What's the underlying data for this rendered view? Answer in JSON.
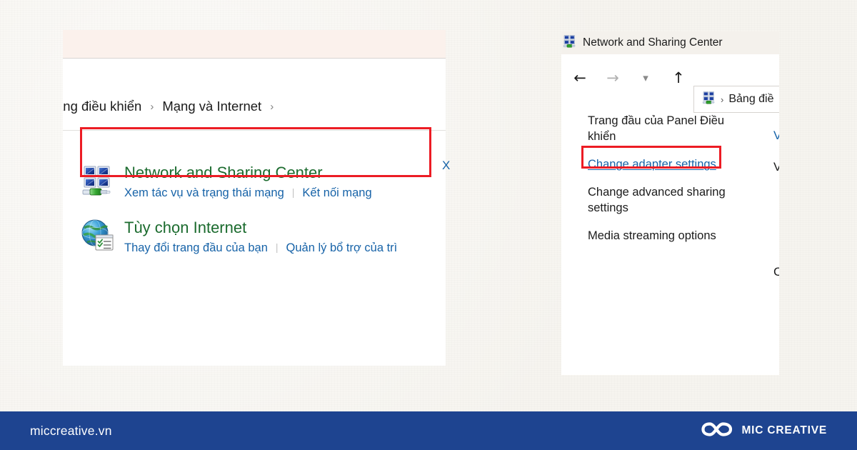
{
  "footer": {
    "url": "miccreative.vn",
    "brand_name": "MIC CREATIVE",
    "logo_icon": "infinity-loop-icon",
    "background_color": "#1e4490",
    "text_color": "#ffffff"
  },
  "left_window": {
    "breadcrumb": {
      "items": [
        "ảng điều khiển",
        "Mạng và Internet"
      ],
      "separator": "›",
      "trailing_separator": "›"
    },
    "categories": [
      {
        "icon": "network-sharing-center-icon",
        "title": "Network and Sharing Center",
        "title_color": "#1b6b2e",
        "links": [
          "Xem tác vụ và trạng thái mạng",
          "Kết nối mạng"
        ],
        "link_color": "#1763a8",
        "highlighted": true
      },
      {
        "icon": "internet-options-globe-icon",
        "title": "Tùy chọn Internet",
        "title_color": "#1b6b2e",
        "links": [
          "Thay đổi trang đầu của bạn",
          "Quản lý bổ trợ của trì"
        ],
        "link_color": "#1763a8",
        "highlighted": false
      }
    ],
    "clipped_link_text": "X"
  },
  "right_window": {
    "title": "Network and Sharing Center",
    "title_icon": "network-sharing-center-icon",
    "nav": {
      "back_icon": "arrow-left-icon",
      "forward_icon": "arrow-right-icon",
      "recent_icon": "chevron-down-icon",
      "up_icon": "arrow-up-icon"
    },
    "address_bar": {
      "icon": "network-sharing-center-icon",
      "separator": "›",
      "value": "Bảng điề"
    },
    "task_links": [
      {
        "label": "Trang đầu của Panel Điều khiển",
        "style": "plain",
        "highlighted": false
      },
      {
        "label": "Change adapter settings",
        "style": "link",
        "highlighted": true
      },
      {
        "label": "Change advanced sharing settings",
        "style": "plain",
        "highlighted": false
      },
      {
        "label": "Media streaming options",
        "style": "plain",
        "highlighted": false
      }
    ],
    "clipped_text": [
      "V",
      "V",
      "C"
    ]
  },
  "highlight": {
    "color": "#ec1c24",
    "label_network": "Network and Sharing Center highlight",
    "label_adapter": "Change adapter settings highlight"
  }
}
